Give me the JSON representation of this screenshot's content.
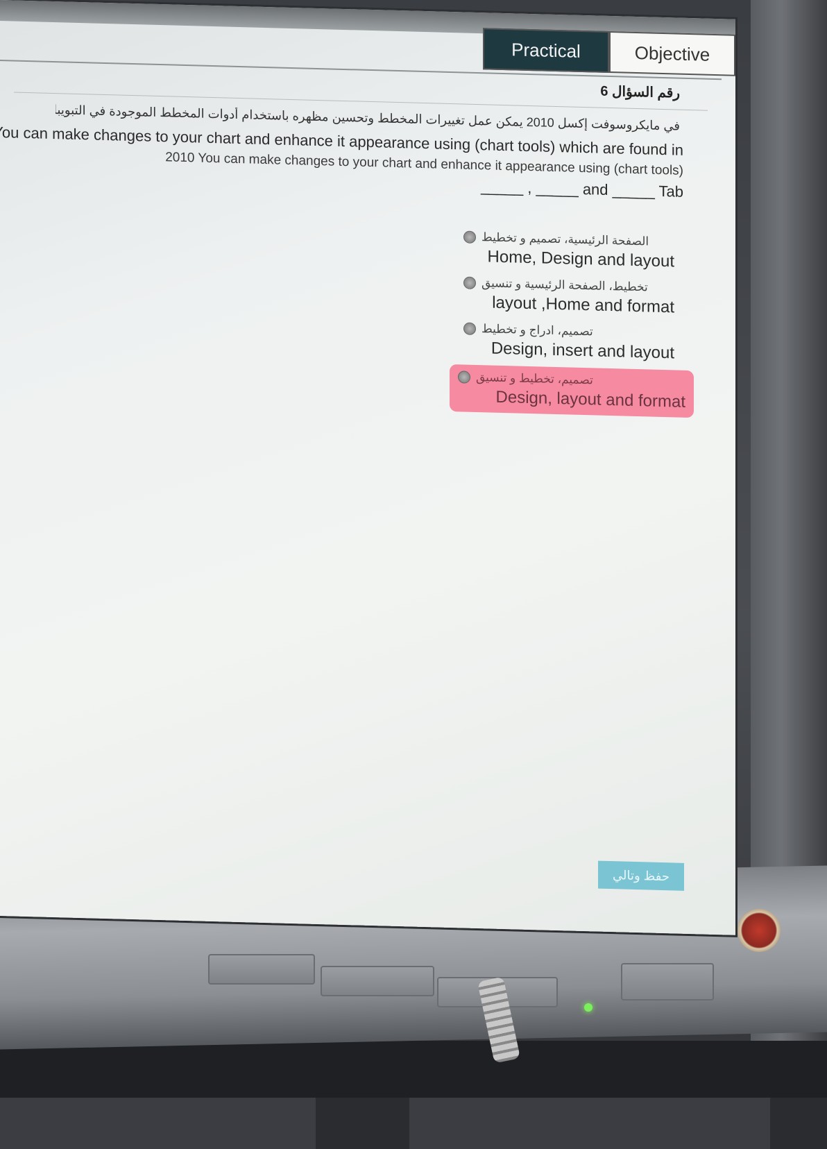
{
  "tabs": [
    {
      "label": "Practical",
      "active": true
    },
    {
      "label": "Objective",
      "active": false
    }
  ],
  "question": {
    "number_label": "رقم السؤال 6",
    "text_ar": "في مايكروسوفت إكسل 2010 يمكن عمل تغييرات المخطط وتحسين مظهره باستخدام أدوات المخطط الموجودة في التبويبات _____ , _____",
    "text_en_line1": "You can make changes to your chart and enhance it appearance using (chart tools) which are found in",
    "text_en_line2": "2010 You can make changes to your chart and enhance it appearance using (chart tools)",
    "text_en_line3": "_____ , _____ and _____ Tab"
  },
  "options": [
    {
      "ar": "الصفحة الرئيسية، تصميم و تخطيط",
      "en": "Home, Design and layout",
      "highlighted": false
    },
    {
      "ar": "تخطيط، الصفحة الرئيسية و تنسيق",
      "en": "layout ,Home and format",
      "highlighted": false
    },
    {
      "ar": "تصميم، ادراج و تخطيط",
      "en": "Design, insert and layout",
      "highlighted": false
    },
    {
      "ar": "تصميم، تخطيط و تنسيق",
      "en": "Design, layout and format",
      "highlighted": true
    }
  ],
  "save_button": "حفظ وتالي",
  "colors": {
    "active_tab": "#1f3940",
    "highlight": "#f66c8a",
    "save_button": "#7bc4d3"
  }
}
